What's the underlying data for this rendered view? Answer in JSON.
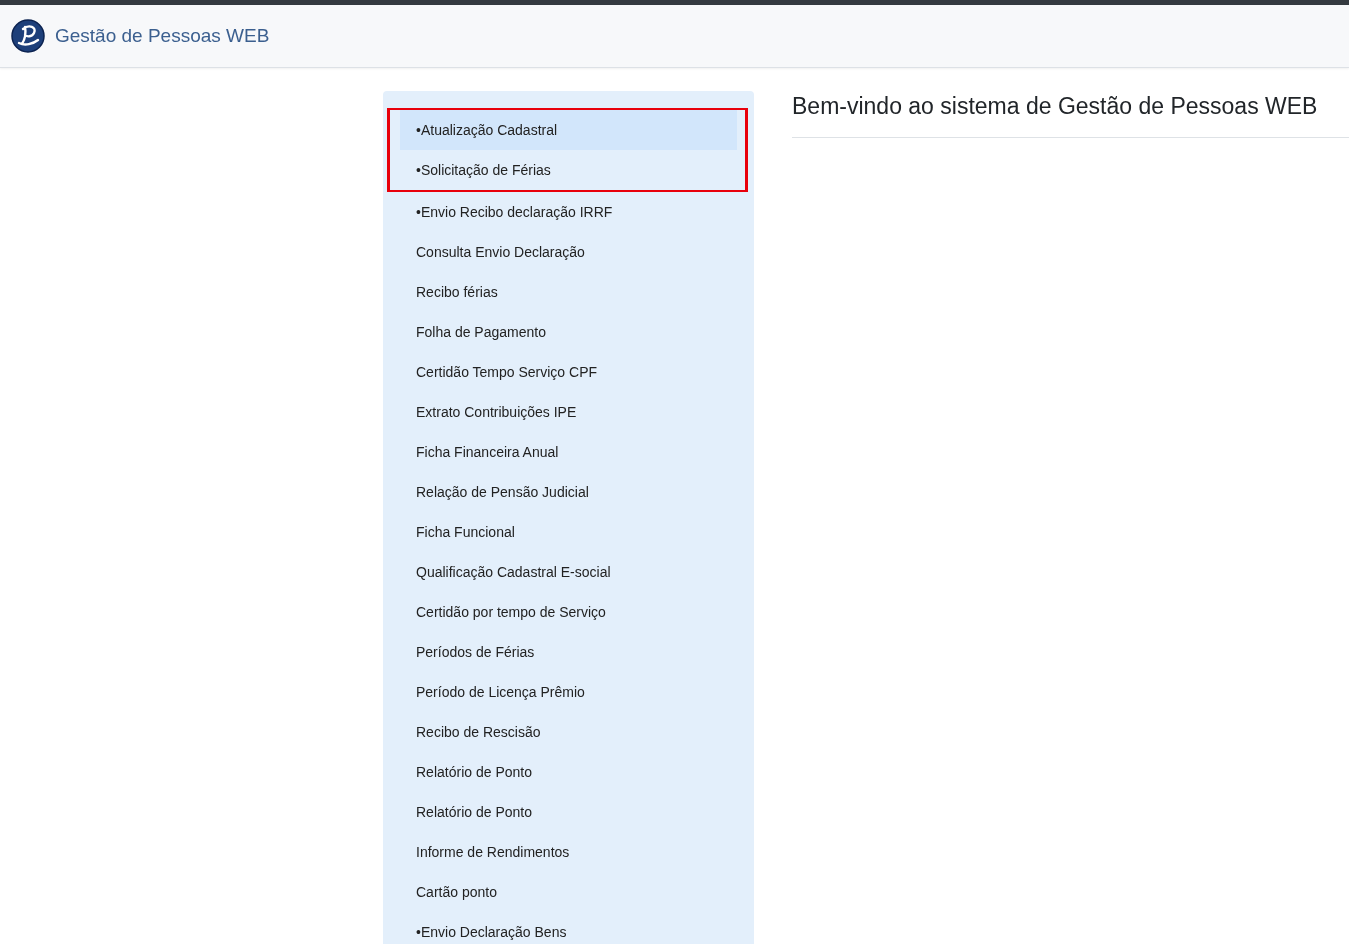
{
  "header": {
    "title": "Gestão de Pessoas WEB"
  },
  "menu": {
    "groups": [
      {
        "outlined": true,
        "items": [
          {
            "label": "•Atualização Cadastral",
            "selected": true
          },
          {
            "label": "•Solicitação de Férias",
            "selected": false
          }
        ]
      },
      {
        "outlined": false,
        "items": [
          {
            "label": "•Envio Recibo declaração IRRF",
            "selected": false
          },
          {
            "label": "Consulta Envio Declaração",
            "selected": false
          },
          {
            "label": "Recibo férias",
            "selected": false
          },
          {
            "label": "Folha de Pagamento",
            "selected": false
          },
          {
            "label": "Certidão Tempo Serviço CPF",
            "selected": false
          },
          {
            "label": "Extrato Contribuições IPE",
            "selected": false
          },
          {
            "label": "Ficha Financeira Anual",
            "selected": false
          },
          {
            "label": "Relação de Pensão Judicial",
            "selected": false
          },
          {
            "label": "Ficha Funcional",
            "selected": false
          },
          {
            "label": "Qualificação Cadastral E-social",
            "selected": false
          },
          {
            "label": "Certidão por tempo de Serviço",
            "selected": false
          },
          {
            "label": "Períodos de Férias",
            "selected": false
          },
          {
            "label": "Período de Licença Prêmio",
            "selected": false
          },
          {
            "label": "Recibo de Rescisão",
            "selected": false
          },
          {
            "label": "Relatório de Ponto",
            "selected": false
          },
          {
            "label": "Relatório de Ponto",
            "selected": false
          },
          {
            "label": "Informe de Rendimentos",
            "selected": false
          },
          {
            "label": "Cartão ponto",
            "selected": false
          },
          {
            "label": "•Envio Declaração Bens",
            "selected": false
          }
        ]
      }
    ]
  },
  "main": {
    "heading": "Bem-vindo ao sistema de Gestão de Pessoas WEB"
  }
}
